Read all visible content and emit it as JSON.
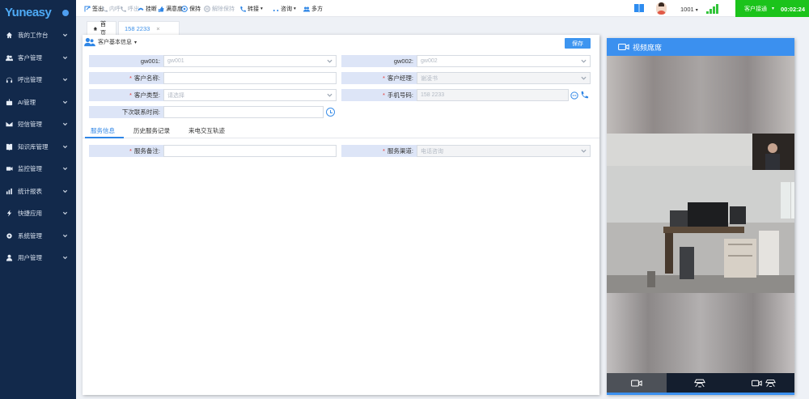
{
  "app": {
    "logo": "Yuneasy"
  },
  "sidebar": {
    "items": [
      {
        "label": "我的工作台",
        "icon": "home-icon"
      },
      {
        "label": "客户管理",
        "icon": "users-icon"
      },
      {
        "label": "呼出管理",
        "icon": "headset-icon"
      },
      {
        "label": "AI管理",
        "icon": "robot-icon"
      },
      {
        "label": "短信管理",
        "icon": "mail-icon"
      },
      {
        "label": "知识库管理",
        "icon": "book-icon"
      },
      {
        "label": "监控管理",
        "icon": "camera-icon"
      },
      {
        "label": "统计报表",
        "icon": "chart-icon"
      },
      {
        "label": "快捷应用",
        "icon": "lightning-icon"
      },
      {
        "label": "系统管理",
        "icon": "gear-icon"
      },
      {
        "label": "用户管理",
        "icon": "user-icon"
      }
    ]
  },
  "toolbar": {
    "items": [
      {
        "label": "签出",
        "icon": "signout-icon",
        "disabled": false
      },
      {
        "label": "内呼",
        "icon": "internal-call-icon",
        "disabled": true
      },
      {
        "label": "呼出",
        "icon": "outbound-call-icon",
        "disabled": true
      },
      {
        "label": "挂断",
        "icon": "hangup-icon",
        "disabled": false
      },
      {
        "label": "满意度",
        "icon": "thumb-icon",
        "disabled": false
      },
      {
        "label": "保持",
        "icon": "hold-icon",
        "disabled": false
      },
      {
        "label": "解除保持",
        "icon": "unhold-icon",
        "disabled": true
      },
      {
        "label": "转接",
        "icon": "transfer-icon",
        "disabled": false
      },
      {
        "label": "咨询",
        "icon": "consult-icon",
        "disabled": false
      },
      {
        "label": "多方",
        "icon": "conference-icon",
        "disabled": false
      }
    ],
    "extension": "1001",
    "status_label": "客户接通",
    "timer": "00:02:24"
  },
  "tabs": [
    {
      "label": "首页"
    },
    {
      "label": "158 2233",
      "close": "×"
    }
  ],
  "form": {
    "section_title": "客户基本信息",
    "save_label": "保存",
    "gw001_label": "gw001:",
    "gw001_placeholder": "gw001",
    "gw002_label": "gw002:",
    "gw002_placeholder": "gw002",
    "name_label": "客户名称:",
    "manager_label": "客户经理:",
    "manager_value": "谢凌书",
    "type_label": "客户类型:",
    "type_placeholder": "请选择",
    "phone_label": "手机号码:",
    "phone_value": "158 2233",
    "next_contact_label": "下次联系时间:",
    "required_mark": "*"
  },
  "subtabs": [
    {
      "label": "服务信息"
    },
    {
      "label": "历史服务记录"
    },
    {
      "label": "来电交互轨迹"
    }
  ],
  "service": {
    "note_label": "服务备注:",
    "channel_label": "服务渠道:",
    "channel_value": "电话咨询"
  },
  "video": {
    "title": "视频席席"
  }
}
